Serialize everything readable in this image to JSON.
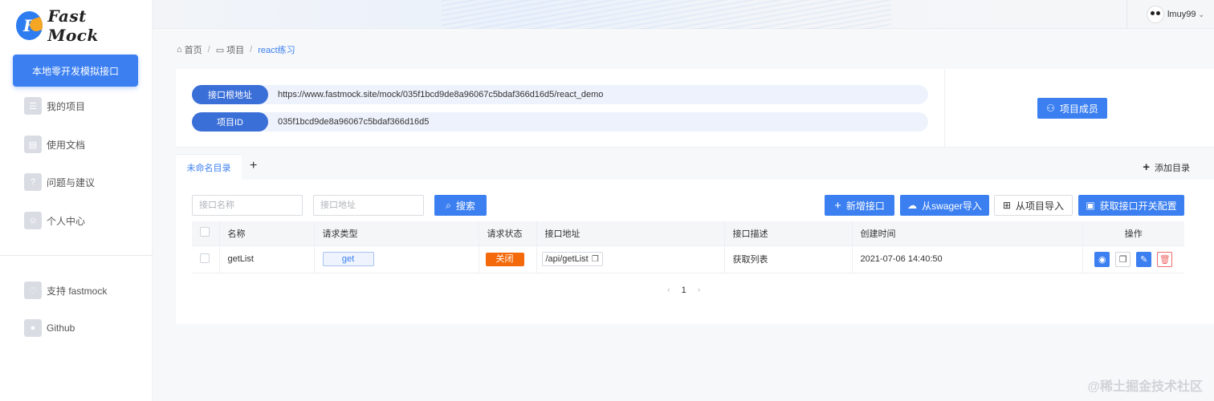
{
  "app": {
    "logo_text": "Fast Mock",
    "logo_letter": "F"
  },
  "sidebar": {
    "primary_button": "本地零开发模拟接口",
    "items": [
      {
        "label": "我的项目",
        "icon": "list-icon"
      },
      {
        "label": "使用文档",
        "icon": "document-icon"
      },
      {
        "label": "问题与建议",
        "icon": "question-icon"
      },
      {
        "label": "个人中心",
        "icon": "user-icon"
      }
    ],
    "footer_items": [
      {
        "label": "支持 fastmock",
        "icon": "heart-icon"
      },
      {
        "label": "Github",
        "icon": "github-icon"
      }
    ]
  },
  "header": {
    "username": "lmuy99"
  },
  "breadcrumb": {
    "home": "首页",
    "project": "项目",
    "current": "react练习"
  },
  "project_info": {
    "base_url_label": "接口根地址",
    "base_url": "https://www.fastmock.site/mock/035f1bcd9de8a96067c5bdaf366d16d5/react_demo",
    "id_label": "项目ID",
    "id": "035f1bcd9de8a96067c5bdaf366d16d5",
    "members_button": "项目成员"
  },
  "tabs": {
    "active": "未命名目录",
    "add_symbol": "+",
    "add_directory": "添加目录"
  },
  "toolbar": {
    "name_placeholder": "接口名称",
    "url_placeholder": "接口地址",
    "search_button": "搜索",
    "new_button": "新增接口",
    "swagger_button": "从swager导入",
    "import_project_button": "从项目导入",
    "switch_config_button": "获取接口开关配置"
  },
  "table": {
    "headers": [
      "名称",
      "请求类型",
      "请求状态",
      "接口地址",
      "接口描述",
      "创建时间",
      "操作"
    ],
    "rows": [
      {
        "name": "getList",
        "method": "get",
        "status": "关闭",
        "url": "/api/getList",
        "description": "获取列表",
        "created": "2021-07-06 14:40:50"
      }
    ]
  },
  "pagination": {
    "current_page": "1",
    "prev": "‹",
    "next": "›"
  },
  "watermark": "@稀土掘金技术社区",
  "colors": {
    "primary": "#3b7ff0",
    "status_closed": "#f46a0a",
    "danger": "#f06b6b"
  }
}
